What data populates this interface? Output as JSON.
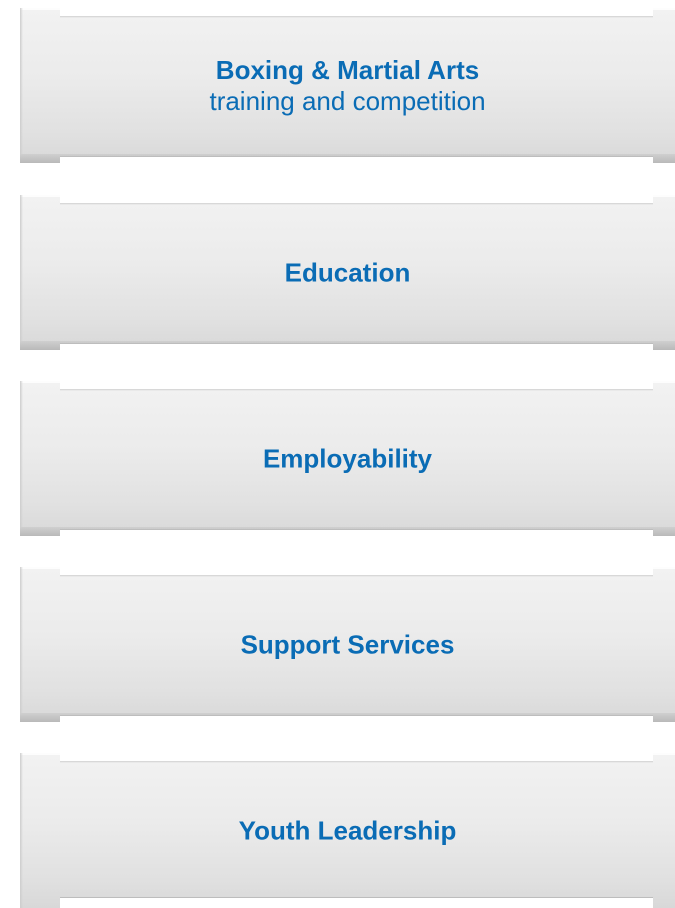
{
  "panels": [
    {
      "title": "Boxing & Martial Arts",
      "subtitle": "training and competition"
    },
    {
      "title": "Education"
    },
    {
      "title": "Employability"
    },
    {
      "title": "Support Services"
    },
    {
      "title": "Youth Leadership"
    }
  ],
  "colors": {
    "text": "#0a6cb5",
    "panel": "#ebebeb"
  }
}
